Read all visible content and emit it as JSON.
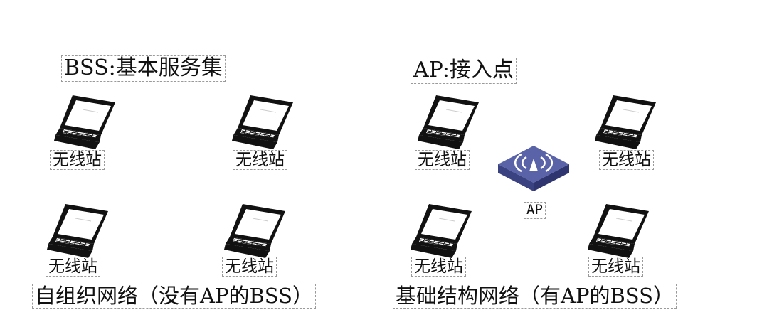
{
  "left": {
    "title": "BSS:基本服务集",
    "caption": "自组织网络（没有AP的BSS）",
    "stations": [
      "无线站",
      "无线站",
      "无线站",
      "无线站"
    ]
  },
  "right": {
    "title": "AP:接入点",
    "caption": "基础结构网络（有AP的BSS）",
    "stations": [
      "无线站",
      "无线站",
      "无线站",
      "无线站"
    ],
    "ap_label": "AP"
  },
  "icons": {
    "station": "laptop-icon",
    "access_point": "wireless-access-point-icon"
  },
  "colors": {
    "ap_top": "#5a63a8",
    "ap_side": "#3b4282",
    "ap_symbol": "#ffffff",
    "border": "#9a9a9a"
  }
}
